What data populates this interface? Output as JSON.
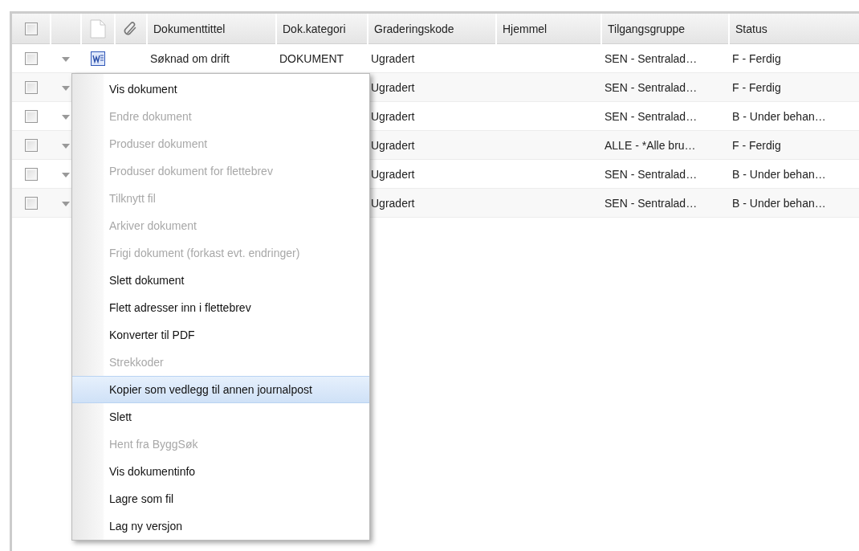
{
  "table": {
    "select_all_checked": false,
    "columns": [
      "Dokumenttittel",
      "Dok.kategori",
      "Graderingskode",
      "Hjemmel",
      "Tilgangsgruppe",
      "Status"
    ],
    "rows": [
      {
        "checked": false,
        "title": "Søknad om drift",
        "category": "DOKUMENT",
        "grade": "Ugradert",
        "access": "SEN - Sentralad…",
        "status": "F - Ferdig"
      },
      {
        "checked": false,
        "grade": "Ugradert",
        "access": "SEN - Sentralad…",
        "status": "F - Ferdig"
      },
      {
        "checked": false,
        "grade": "Ugradert",
        "access": "SEN - Sentralad…",
        "status": "B - Under behan…"
      },
      {
        "checked": false,
        "grade": "Ugradert",
        "access": "ALLE - *Alle bru…",
        "status": "F - Ferdig"
      },
      {
        "checked": false,
        "grade": "Ugradert",
        "access": "SEN - Sentralad…",
        "status": "B - Under behan…"
      },
      {
        "checked": false,
        "grade": "Ugradert",
        "access": "SEN - Sentralad…",
        "status": "B - Under behan…"
      }
    ]
  },
  "context_menu": {
    "items": [
      {
        "label": "Vis dokument",
        "disabled": false,
        "selected": false
      },
      {
        "label": "Endre dokument",
        "disabled": true,
        "selected": false
      },
      {
        "label": "Produser dokument",
        "disabled": true,
        "selected": false
      },
      {
        "label": "Produser dokument for flettebrev",
        "disabled": true,
        "selected": false
      },
      {
        "label": "Tilknytt fil",
        "disabled": true,
        "selected": false
      },
      {
        "label": "Arkiver dokument",
        "disabled": true,
        "selected": false
      },
      {
        "label": "Frigi dokument (forkast evt. endringer)",
        "disabled": true,
        "selected": false
      },
      {
        "label": "Slett dokument",
        "disabled": false,
        "selected": false
      },
      {
        "label": "Flett adresser inn i flettebrev",
        "disabled": false,
        "selected": false
      },
      {
        "label": "Konverter til PDF",
        "disabled": false,
        "selected": false
      },
      {
        "label": "Strekkoder",
        "disabled": true,
        "selected": false
      },
      {
        "label": "Kopier som vedlegg til annen journalpost",
        "disabled": false,
        "selected": true
      },
      {
        "label": "Slett",
        "disabled": false,
        "selected": false
      },
      {
        "label": "Hent fra ByggSøk",
        "disabled": true,
        "selected": false
      },
      {
        "label": "Vis dokumentinfo",
        "disabled": false,
        "selected": false
      },
      {
        "label": "Lagre som fil",
        "disabled": false,
        "selected": false
      },
      {
        "label": "Lag ny versjon",
        "disabled": false,
        "selected": false
      }
    ]
  }
}
